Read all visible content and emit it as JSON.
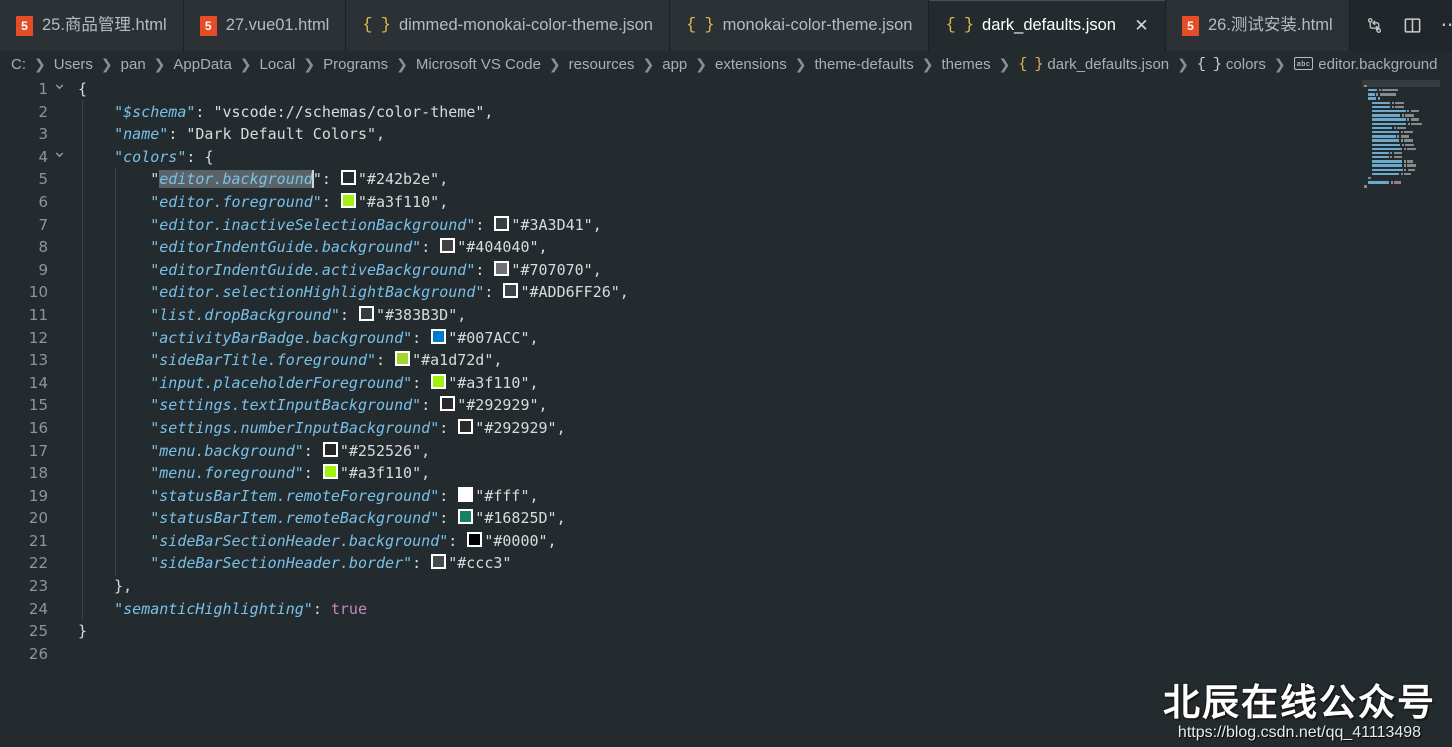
{
  "window": {
    "background": "#242b2e",
    "tabbar_background": "#21262a"
  },
  "tabs": [
    {
      "label": "25.商品管理.html",
      "icon": "html5-icon",
      "active": false,
      "has_close": false
    },
    {
      "label": "27.vue01.html",
      "icon": "html5-icon",
      "active": false,
      "has_close": false
    },
    {
      "label": "dimmed-monokai-color-theme.json",
      "icon": "json-icon",
      "active": false,
      "has_close": false
    },
    {
      "label": "monokai-color-theme.json",
      "icon": "json-icon",
      "active": false,
      "has_close": false
    },
    {
      "label": "dark_defaults.json",
      "icon": "json-icon",
      "active": true,
      "has_close": true,
      "close_label": "✕"
    },
    {
      "label": "26.测试安装.html",
      "icon": "html5-icon",
      "active": false,
      "has_close": false
    }
  ],
  "tabbar_actions": [
    {
      "name": "split-compare-icon",
      "label": ""
    },
    {
      "name": "split-editor-icon",
      "label": ""
    },
    {
      "name": "more-actions-icon",
      "label": "⋯"
    }
  ],
  "breadcrumb": {
    "separator": "❯",
    "items": [
      {
        "label": "C:",
        "icon": ""
      },
      {
        "label": "Users",
        "icon": ""
      },
      {
        "label": "pan",
        "icon": ""
      },
      {
        "label": "AppData",
        "icon": ""
      },
      {
        "label": "Local",
        "icon": ""
      },
      {
        "label": "Programs",
        "icon": ""
      },
      {
        "label": "Microsoft VS Code",
        "icon": ""
      },
      {
        "label": "resources",
        "icon": ""
      },
      {
        "label": "app",
        "icon": ""
      },
      {
        "label": "extensions",
        "icon": ""
      },
      {
        "label": "theme-defaults",
        "icon": ""
      },
      {
        "label": "themes",
        "icon": ""
      },
      {
        "label": "dark_defaults.json",
        "icon": "json-file-icon"
      },
      {
        "label": "colors",
        "icon": "json-object-icon"
      },
      {
        "label": "editor.background",
        "icon": "string-property-icon"
      }
    ]
  },
  "editor": {
    "language": "json",
    "total_lines": 26,
    "cursor_line": 5,
    "selection_text": "editor.background",
    "lines": [
      {
        "num": 1,
        "fold": "chevron-down",
        "indent": 0,
        "kind": "brace",
        "text": "{"
      },
      {
        "num": 2,
        "fold": "",
        "indent": 1,
        "kind": "pair",
        "key": "$schema",
        "value": "vscode://schemas/color-theme",
        "swatch": "",
        "comma": true
      },
      {
        "num": 3,
        "fold": "",
        "indent": 1,
        "kind": "pair",
        "key": "name",
        "value": "Dark Default Colors",
        "swatch": "",
        "comma": true
      },
      {
        "num": 4,
        "fold": "chevron-down",
        "indent": 1,
        "kind": "objkey",
        "key": "colors",
        "text": "{"
      },
      {
        "num": 5,
        "fold": "",
        "indent": 2,
        "kind": "pair",
        "key": "editor.background",
        "value": "#242b2e",
        "swatch": "#242b2e",
        "comma": true,
        "selected": true
      },
      {
        "num": 6,
        "fold": "",
        "indent": 2,
        "kind": "pair",
        "key": "editor.foreground",
        "value": "#a3f110",
        "swatch": "#a3f110",
        "comma": true
      },
      {
        "num": 7,
        "fold": "",
        "indent": 2,
        "kind": "pair",
        "key": "editor.inactiveSelectionBackground",
        "value": "#3A3D41",
        "swatch": "#3A3D41",
        "comma": true
      },
      {
        "num": 8,
        "fold": "",
        "indent": 2,
        "kind": "pair",
        "key": "editorIndentGuide.background",
        "value": "#404040",
        "swatch": "#404040",
        "comma": true
      },
      {
        "num": 9,
        "fold": "",
        "indent": 2,
        "kind": "pair",
        "key": "editorIndentGuide.activeBackground",
        "value": "#707070",
        "swatch": "#707070",
        "comma": true
      },
      {
        "num": 10,
        "fold": "",
        "indent": 2,
        "kind": "pair",
        "key": "editor.selectionHighlightBackground",
        "value": "#ADD6FF26",
        "swatch": "#ADD6FF26",
        "comma": true
      },
      {
        "num": 11,
        "fold": "",
        "indent": 2,
        "kind": "pair",
        "key": "list.dropBackground",
        "value": "#383B3D",
        "swatch": "#383B3D",
        "comma": true
      },
      {
        "num": 12,
        "fold": "",
        "indent": 2,
        "kind": "pair",
        "key": "activityBarBadge.background",
        "value": "#007ACC",
        "swatch": "#007ACC",
        "comma": true
      },
      {
        "num": 13,
        "fold": "",
        "indent": 2,
        "kind": "pair",
        "key": "sideBarTitle.foreground",
        "value": "#a1d72d",
        "swatch": "#a1d72d",
        "comma": true
      },
      {
        "num": 14,
        "fold": "",
        "indent": 2,
        "kind": "pair",
        "key": "input.placeholderForeground",
        "value": "#a3f110",
        "swatch": "#a3f110",
        "comma": true
      },
      {
        "num": 15,
        "fold": "",
        "indent": 2,
        "kind": "pair",
        "key": "settings.textInputBackground",
        "value": "#292929",
        "swatch": "#292929",
        "comma": true
      },
      {
        "num": 16,
        "fold": "",
        "indent": 2,
        "kind": "pair",
        "key": "settings.numberInputBackground",
        "value": "#292929",
        "swatch": "#292929",
        "comma": true
      },
      {
        "num": 17,
        "fold": "",
        "indent": 2,
        "kind": "pair",
        "key": "menu.background",
        "value": "#252526",
        "swatch": "#252526",
        "comma": true
      },
      {
        "num": 18,
        "fold": "",
        "indent": 2,
        "kind": "pair",
        "key": "menu.foreground",
        "value": "#a3f110",
        "swatch": "#a3f110",
        "comma": true
      },
      {
        "num": 19,
        "fold": "",
        "indent": 2,
        "kind": "pair",
        "key": "statusBarItem.remoteForeground",
        "value": "#fff",
        "swatch": "#ffffff",
        "comma": true
      },
      {
        "num": 20,
        "fold": "",
        "indent": 2,
        "kind": "pair",
        "key": "statusBarItem.remoteBackground",
        "value": "#16825D",
        "swatch": "#16825D",
        "comma": true
      },
      {
        "num": 21,
        "fold": "",
        "indent": 2,
        "kind": "pair",
        "key": "sideBarSectionHeader.background",
        "value": "#0000",
        "swatch": "#000000",
        "comma": true
      },
      {
        "num": 22,
        "fold": "",
        "indent": 2,
        "kind": "pair",
        "key": "sideBarSectionHeader.border",
        "value": "#ccc3",
        "swatch": "#cccccc33",
        "comma": false
      },
      {
        "num": 23,
        "fold": "",
        "indent": 1,
        "kind": "brace",
        "text": "},"
      },
      {
        "num": 24,
        "fold": "",
        "indent": 1,
        "kind": "boolpair",
        "key": "semanticHighlighting",
        "value": "true"
      },
      {
        "num": 25,
        "fold": "",
        "indent": 0,
        "kind": "brace",
        "text": "}"
      },
      {
        "num": 26,
        "fold": "",
        "indent": 0,
        "kind": "empty",
        "text": ""
      }
    ]
  },
  "theme_tokens": {
    "property_key": "#79c0e8",
    "string_value": "#d7dbdd",
    "boolean": "#c586c0",
    "line_number": "#8f9598",
    "punctuation": "#d7dbdd"
  },
  "watermark": {
    "title": "北辰在线公众号",
    "url": "https://blog.csdn.net/qq_41113498"
  }
}
